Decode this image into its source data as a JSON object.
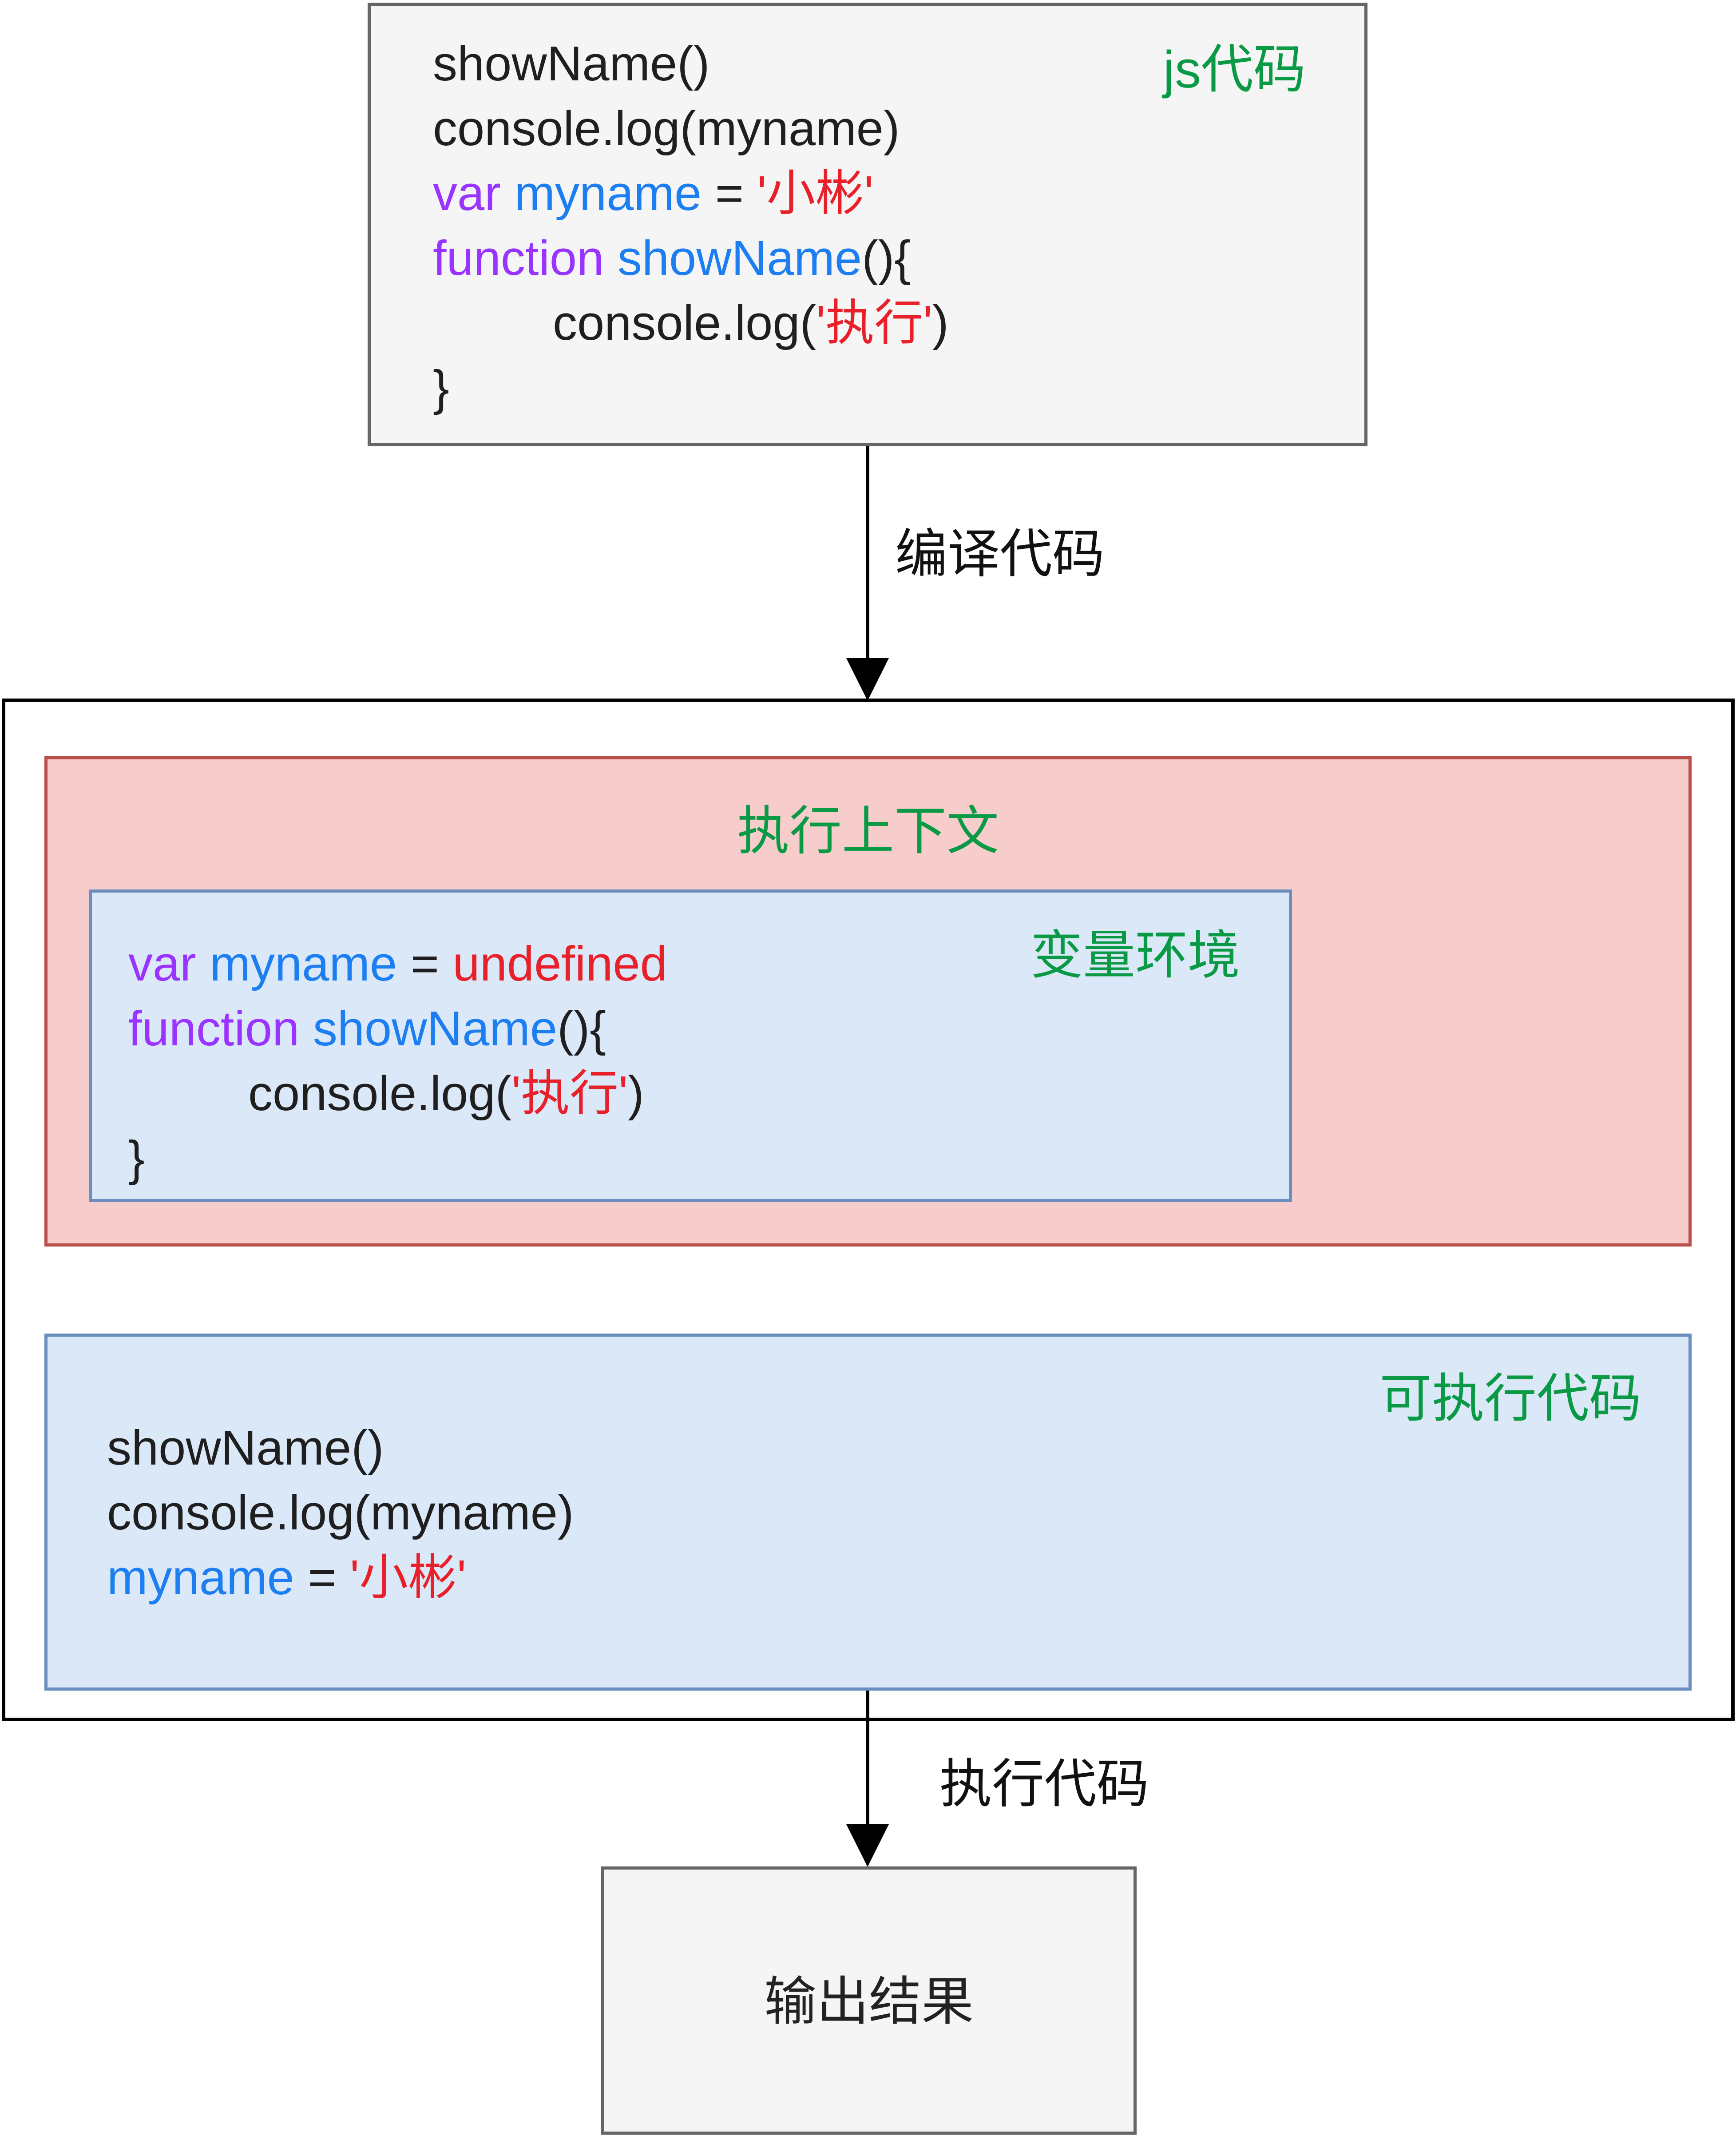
{
  "source_code": {
    "label": "js代码",
    "lines": {
      "l1": "showName()",
      "l2": "console.log(myname)",
      "l3": {
        "kw": "var",
        "id": "myname",
        "op": " = ",
        "str": "'小彬'"
      },
      "l4": {
        "kw": "function",
        "id": "showName",
        "rest": "(){"
      },
      "l5": {
        "pre": "console.log(",
        "str": "'执行'",
        "post": ")"
      },
      "l6": "}"
    }
  },
  "edge_compile": {
    "label": "编译代码"
  },
  "execution_context": {
    "label": "执行上下文",
    "variable_environment": {
      "label": "变量环境",
      "lines": {
        "l1": {
          "kw": "var",
          "id": "myname",
          "op": " = ",
          "val": "undefined"
        },
        "l2": {
          "kw": "function",
          "id": "showName",
          "rest": "(){"
        },
        "l3": {
          "pre": "console.log(",
          "str": "'执行'",
          "post": ")"
        },
        "l4": "}"
      }
    }
  },
  "executable_code": {
    "label": "可执行代码",
    "lines": {
      "l1": "showName()",
      "l2": "console.log(myname)",
      "l3": {
        "id": "myname",
        "op": " = ",
        "str": "'小彬'"
      }
    }
  },
  "edge_execute": {
    "label": "执行代码"
  },
  "output": {
    "label": "输出结果"
  },
  "colors": {
    "keyword": "#9933ff",
    "identifier": "#1c7ef0",
    "string": "#e8202a",
    "label_green": "#0a9a45",
    "context_fill": "#f6cdcb",
    "context_border": "#b9504c",
    "env_fill": "#dbe8f8",
    "env_border": "#6c8ebf",
    "gray_fill": "#f5f5f5",
    "gray_border": "#666666"
  }
}
